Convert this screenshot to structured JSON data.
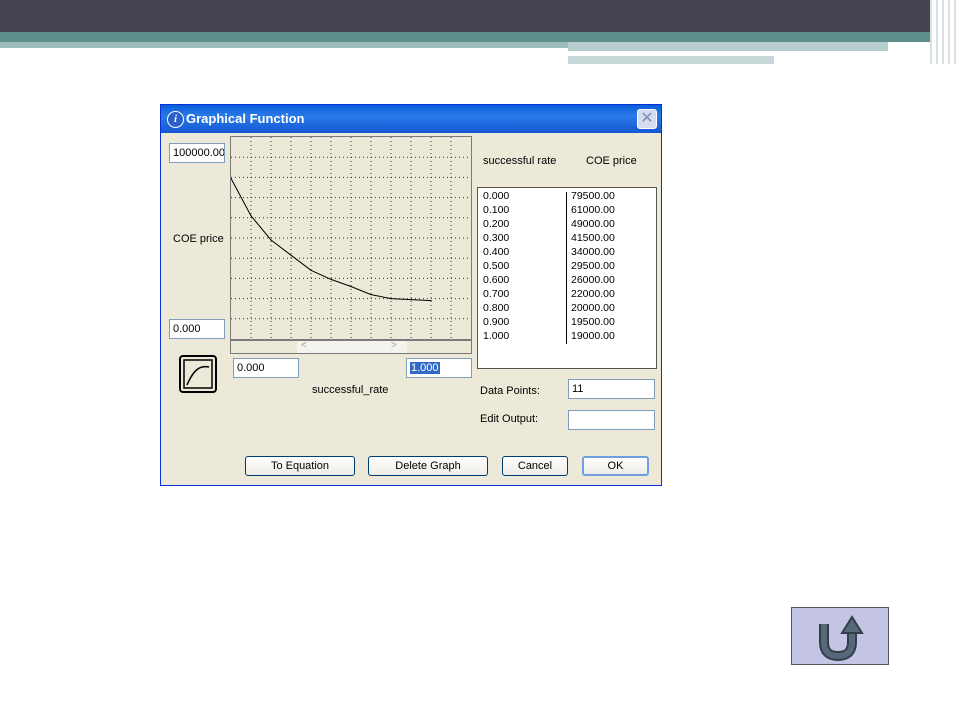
{
  "dialog": {
    "title": "Graphical Function",
    "close_glyph": "✕",
    "y_max": "100000.00",
    "y_label": "COE price",
    "y_min": "0.000",
    "x_min": "0.000",
    "x_max": "1.000",
    "x_label": "successful_rate",
    "table_headers": [
      "successful rate",
      "COE price"
    ],
    "rows": [
      {
        "x": "0.000",
        "y": "79500.00"
      },
      {
        "x": "0.100",
        "y": "61000.00"
      },
      {
        "x": "0.200",
        "y": "49000.00"
      },
      {
        "x": "0.300",
        "y": "41500.00"
      },
      {
        "x": "0.400",
        "y": "34000.00"
      },
      {
        "x": "0.500",
        "y": "29500.00"
      },
      {
        "x": "0.600",
        "y": "26000.00"
      },
      {
        "x": "0.700",
        "y": "22000.00"
      },
      {
        "x": "0.800",
        "y": "20000.00"
      },
      {
        "x": "0.900",
        "y": "19500.00"
      },
      {
        "x": "1.000",
        "y": "19000.00"
      }
    ],
    "data_points_label": "Data Points:",
    "data_points_value": "11",
    "edit_output_label": "Edit Output:",
    "edit_output_value": "",
    "buttons": {
      "to_equation": "To Equation",
      "delete_graph": "Delete Graph",
      "cancel": "Cancel",
      "ok": "OK"
    }
  },
  "chart_data": {
    "type": "line",
    "x": [
      0.0,
      0.1,
      0.2,
      0.3,
      0.4,
      0.5,
      0.6,
      0.7,
      0.8,
      0.9,
      1.0
    ],
    "values": [
      79500,
      61000,
      49000,
      41500,
      34000,
      29500,
      26000,
      22000,
      20000,
      19500,
      19000
    ],
    "xlim": [
      0,
      1
    ],
    "ylim": [
      0,
      100000
    ],
    "grid": true
  },
  "colors": {
    "titlebar": "#1457d3",
    "dialog_bg": "#ece9d8",
    "back_button": "#c4c4e4",
    "back_icon": "#4a5a68"
  },
  "icons": {
    "info": "info-icon",
    "close": "close-icon",
    "graph_type": "curve-icon",
    "back": "u-turn-arrow-icon"
  }
}
